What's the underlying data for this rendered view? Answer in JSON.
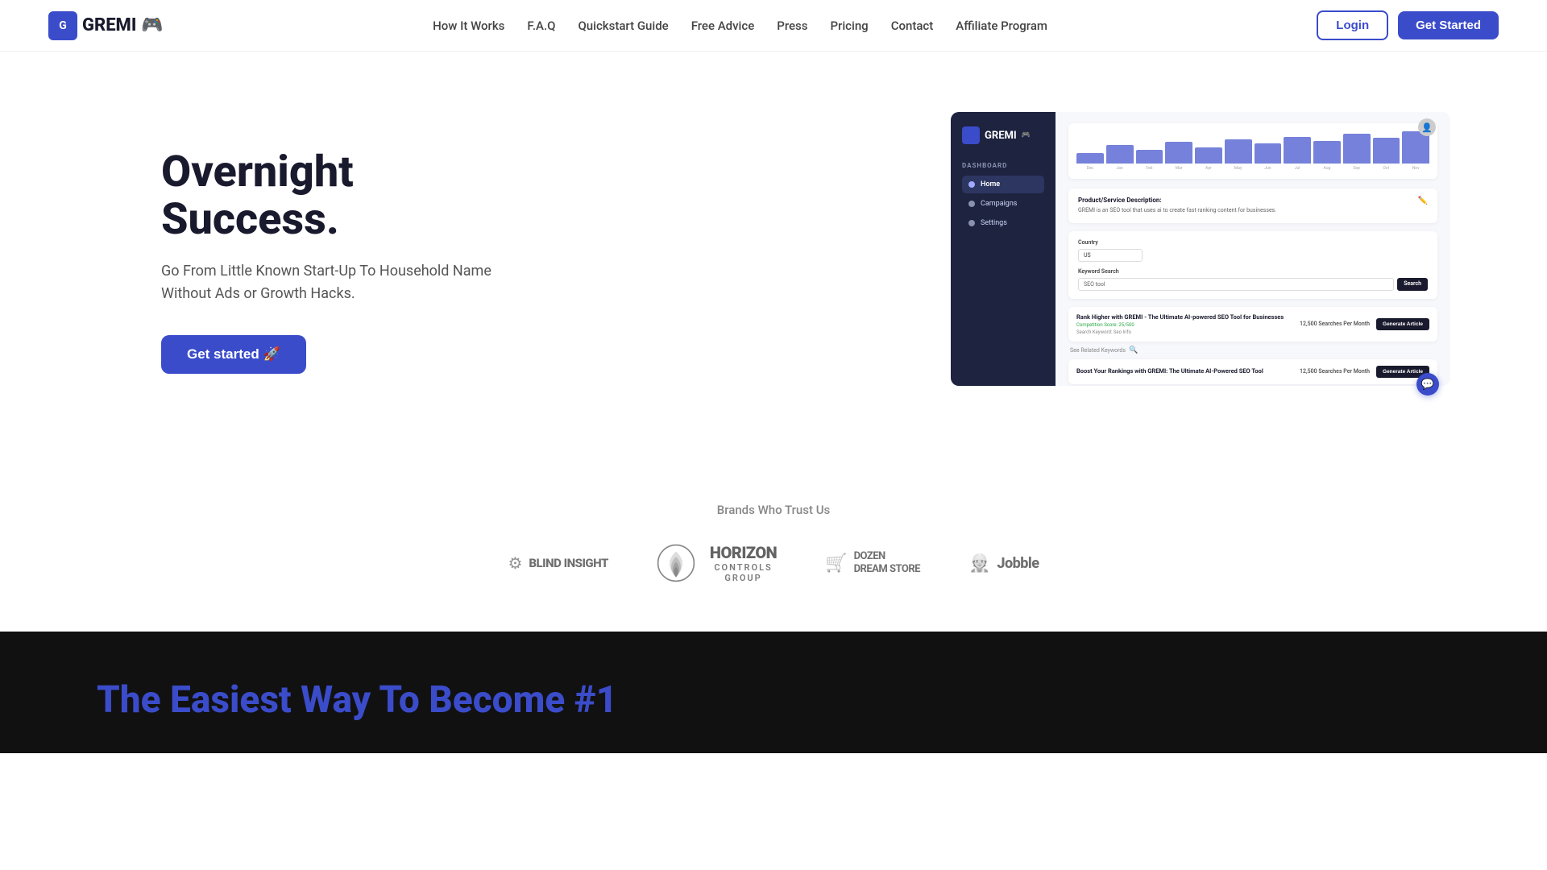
{
  "nav": {
    "logo_text": "GREMI",
    "items": [
      {
        "label": "How It Works",
        "href": "#"
      },
      {
        "label": "F.A.Q",
        "href": "#"
      },
      {
        "label": "Quickstart Guide",
        "href": "#"
      },
      {
        "label": "Free Advice",
        "href": "#"
      },
      {
        "label": "Press",
        "href": "#"
      },
      {
        "label": "Pricing",
        "href": "#"
      },
      {
        "label": "Contact",
        "href": "#"
      },
      {
        "label": "Affiliate Program",
        "href": "#"
      }
    ],
    "login_label": "Login",
    "get_started_label": "Get Started"
  },
  "hero": {
    "title": "Overnight Success.",
    "subtitle": "Go From Little Known Start-Up To Household Name Without Ads or Growth Hacks.",
    "cta_label": "Get started 🚀"
  },
  "mockup": {
    "sidebar_logo": "GREMI",
    "section_label": "DASHBOARD",
    "nav_items": [
      {
        "label": "Home",
        "active": true
      },
      {
        "label": "Campaigns",
        "active": false
      },
      {
        "label": "Settings",
        "active": false
      }
    ],
    "chart_bars": [
      20,
      35,
      25,
      40,
      30,
      45,
      38,
      50,
      42,
      55,
      48,
      60
    ],
    "chart_labels": [
      "Dec",
      "Jan",
      "Feb",
      "Mar",
      "Apr",
      "May",
      "Jun",
      "Jul",
      "Aug",
      "Sep",
      "Oct",
      "Nov"
    ],
    "description_title": "Product/Service Description:",
    "description_text": "GREMI is an SEO tool that uses ai to create fast ranking content for businesses.",
    "country_label": "Country",
    "country_value": "US",
    "keyword_label": "Keyword Search",
    "keyword_placeholder": "SEO tool",
    "search_btn": "Search",
    "results": [
      {
        "title": "Rank Higher with GREMI - The Ultimate AI-powered SEO Tool for Businesses",
        "green_text": "Competition Score: 25/500",
        "gray_text": "Search Keyword: Seo Info",
        "stat": "12,500 Searches Per Month",
        "btn": "Generate Article"
      },
      {
        "title": "Boost Your Rankings with GREMI: The Ultimate AI-Powered SEO Tool",
        "green_text": "",
        "gray_text": "",
        "stat": "12,500 Searches Per Month",
        "btn": "Generate Article"
      }
    ],
    "related_label": "See Related Keywords",
    "chat_icon": "💬"
  },
  "brands": {
    "section_title": "Brands Who Trust Us",
    "logos": [
      {
        "name": "Blind Insight",
        "display": "BLINDINSIGHT",
        "icon": "🔒"
      },
      {
        "name": "Horizon Controls Group",
        "main": "HORIZON",
        "sub1": "CONTROLS",
        "sub2": "GROUP"
      },
      {
        "name": "Dozen Dream Store",
        "display": "DOZENDREAM STORE",
        "icon": "🛒"
      },
      {
        "name": "Jobble",
        "display": "Jobble",
        "icon": "👷"
      }
    ]
  },
  "bottom": {
    "title_part1": "The Easiest Way To Become",
    "title_part2": "#1"
  }
}
